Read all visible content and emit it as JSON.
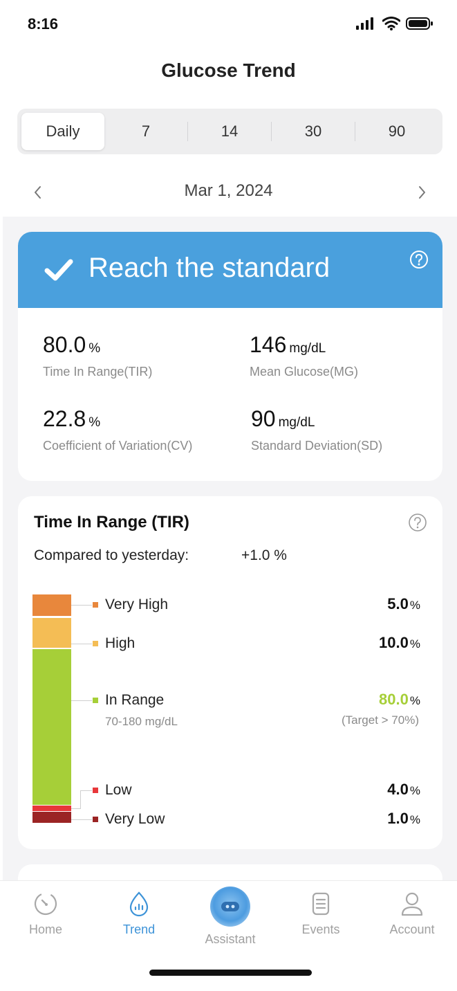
{
  "status": {
    "time": "8:16"
  },
  "page_title": "Glucose Trend",
  "segments": [
    "Daily",
    "7",
    "14",
    "30",
    "90"
  ],
  "segment_active": "Daily",
  "date": "Mar 1, 2024",
  "summary": {
    "title": "Reach the standard",
    "metrics": [
      {
        "value": "80.0",
        "unit": "%",
        "label": "Time In Range(TIR)"
      },
      {
        "value": "146",
        "unit": "mg/dL",
        "label": "Mean Glucose(MG)"
      },
      {
        "value": "22.8",
        "unit": "%",
        "label": "Coefficient of Variation(CV)"
      },
      {
        "value": "90",
        "unit": "mg/dL",
        "label": "Standard Deviation(SD)"
      }
    ]
  },
  "tir": {
    "title": "Time In Range (TIR)",
    "compare_label": "Compared to yesterday:",
    "compare_value": "+1.0  %",
    "rows": [
      {
        "label": "Very High",
        "value": "5.0",
        "unit": "%",
        "color": "#e8873c",
        "percent": 5.0
      },
      {
        "label": "High",
        "value": "10.0",
        "unit": "%",
        "color": "#f4bd55",
        "percent": 10.0
      },
      {
        "label": "In Range",
        "sub": "70-180 mg/dL",
        "value": "80.0",
        "unit": "%",
        "target": "(Target > 70%)",
        "color": "#a6cf38",
        "percent": 80.0
      },
      {
        "label": "Low",
        "value": "4.0",
        "unit": "%",
        "color": "#e8373a",
        "percent": 4.0
      },
      {
        "label": "Very Low",
        "value": "1.0",
        "unit": "%",
        "color": "#9b2424",
        "percent": 1.0
      }
    ]
  },
  "tabs": [
    {
      "label": "Home",
      "icon": "home-dial-icon"
    },
    {
      "label": "Trend",
      "icon": "trend-drop-icon",
      "active": true
    },
    {
      "label": "Assistant",
      "icon": "assistant-icon"
    },
    {
      "label": "Events",
      "icon": "events-icon"
    },
    {
      "label": "Account",
      "icon": "account-icon"
    }
  ],
  "colors": {
    "accent": "#4aa0dd",
    "in_range": "#a6cf38",
    "tab_active": "#3d93d8"
  }
}
